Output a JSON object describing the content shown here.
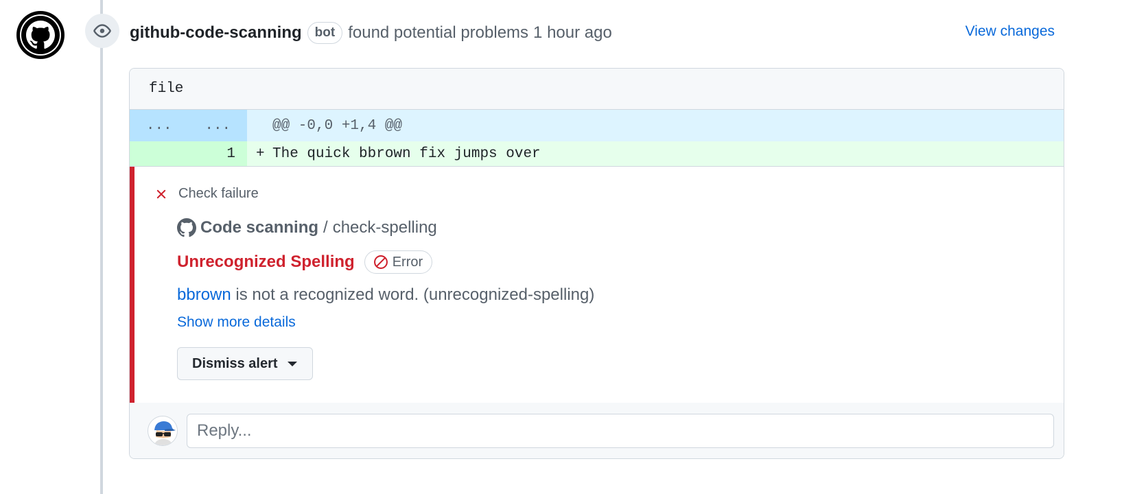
{
  "header": {
    "author": "github-code-scanning",
    "author_badge": "bot",
    "action_text": "found potential problems",
    "time": "1 hour ago",
    "view_changes_label": "View changes",
    "avatar_icon": "github-logo-icon",
    "event_icon": "eye-icon"
  },
  "file": {
    "name": "file",
    "hunk": {
      "old_num": "...",
      "new_num": "...",
      "header": "@@ -0,0 +1,4 @@"
    },
    "added_line": {
      "number": "1",
      "sign": "+",
      "code": "The quick bbrown fix jumps over"
    }
  },
  "alert": {
    "status_label": "Check failure",
    "status_icon": "x-icon",
    "tool_icon": "github-logo-icon",
    "tool_name": "Code scanning",
    "separator": "/",
    "check_name": "check-spelling",
    "rule_title": "Unrecognized Spelling",
    "severity_label": "Error",
    "severity_icon": "stop-icon",
    "message_word": "bbrown",
    "message_rest": "is not a recognized word. (unrecognized-spelling)",
    "more_details_label": "Show more details",
    "dismiss_label": "Dismiss alert"
  },
  "reply": {
    "placeholder": "Reply...",
    "avatar_icon": "user-avatar"
  },
  "colors": {
    "accent": "#0969da",
    "danger": "#cf222e",
    "hunk_bg": "#ddf4ff",
    "added_bg": "#e6ffec"
  }
}
